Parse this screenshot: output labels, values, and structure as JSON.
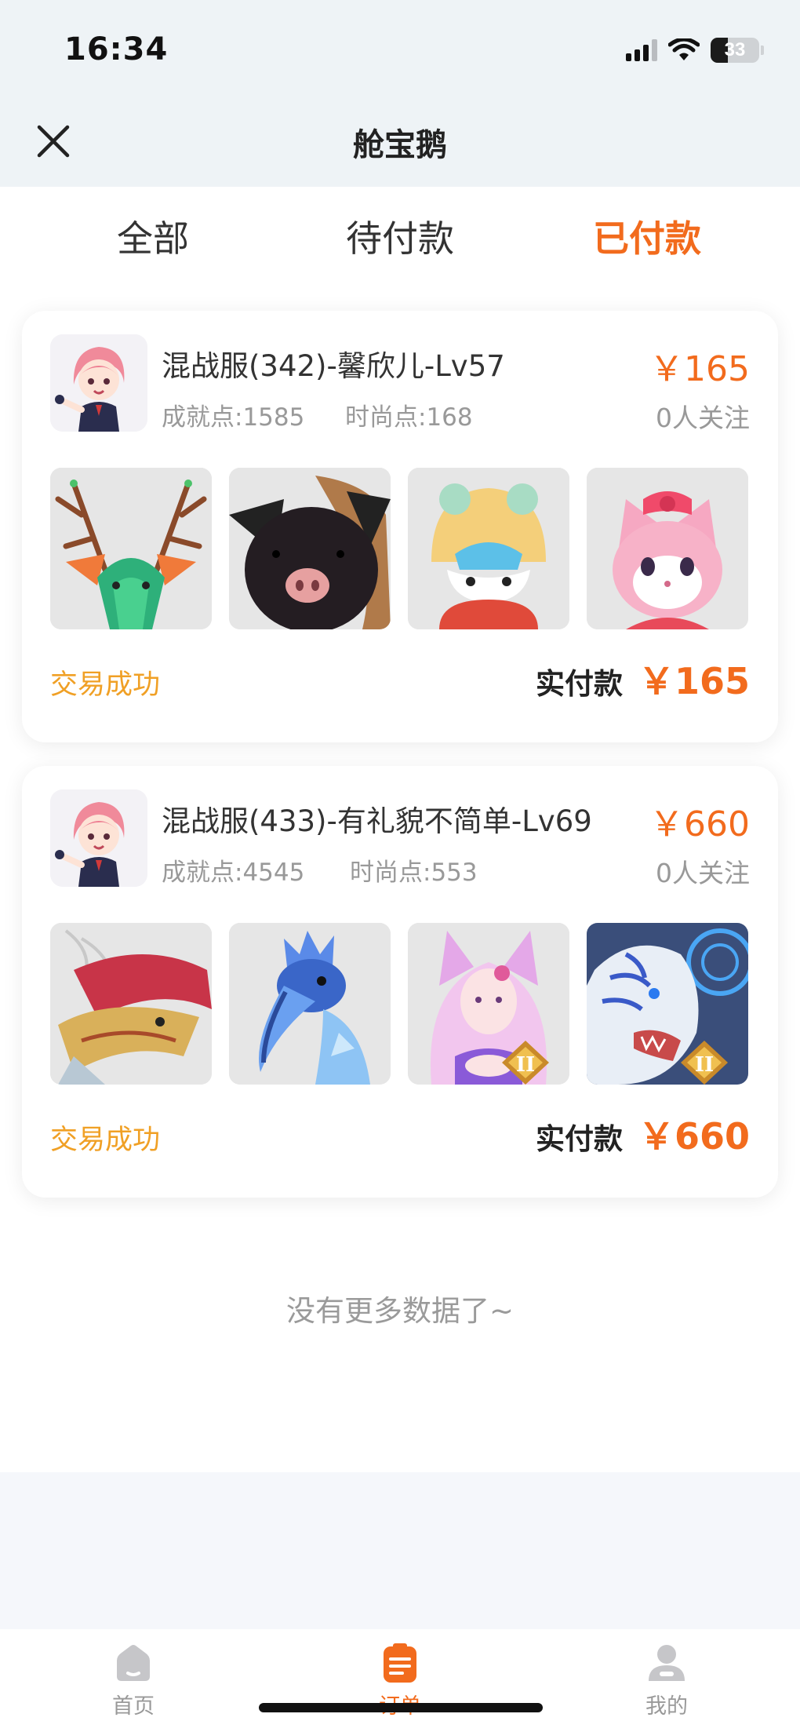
{
  "status_bar": {
    "time": "16:34",
    "battery": "33"
  },
  "nav": {
    "title": "舱宝鹅"
  },
  "tabs": [
    {
      "label": "全部",
      "active": false
    },
    {
      "label": "待付款",
      "active": false
    },
    {
      "label": "已付款",
      "active": true
    }
  ],
  "orders": [
    {
      "title": "混战服(342)-馨欣儿-Lv57",
      "achievement": "成就点:1585",
      "fashion": "时尚点:168",
      "price": "￥165",
      "followers": "0人关注",
      "thumbnails": [
        "green-dragon-antlers",
        "black-pig",
        "lion-hat-bunny",
        "pink-bow-fox"
      ],
      "status": "交易成功",
      "paid_label": "实付款",
      "paid_value": "￥165"
    },
    {
      "title": "混战服(433)-有礼貌不简单-Lv69",
      "achievement": "成就点:4545",
      "fashion": "时尚点:553",
      "price": "￥660",
      "followers": "0人关注",
      "thumbnails": [
        "red-gold-dragon",
        "blue-shoebill",
        "pink-fox-girl",
        "white-tiger"
      ],
      "status": "交易成功",
      "paid_label": "实付款",
      "paid_value": "￥660"
    }
  ],
  "list_end": "没有更多数据了~",
  "tabbar": [
    {
      "label": "首页",
      "icon": "home-icon",
      "active": false
    },
    {
      "label": "订单",
      "icon": "order-icon",
      "active": true
    },
    {
      "label": "我的",
      "icon": "profile-icon",
      "active": false
    }
  ],
  "colors": {
    "accent": "#f26b1d",
    "success": "#f0a025",
    "muted": "#999999",
    "header_bg": "#eef3f6"
  }
}
